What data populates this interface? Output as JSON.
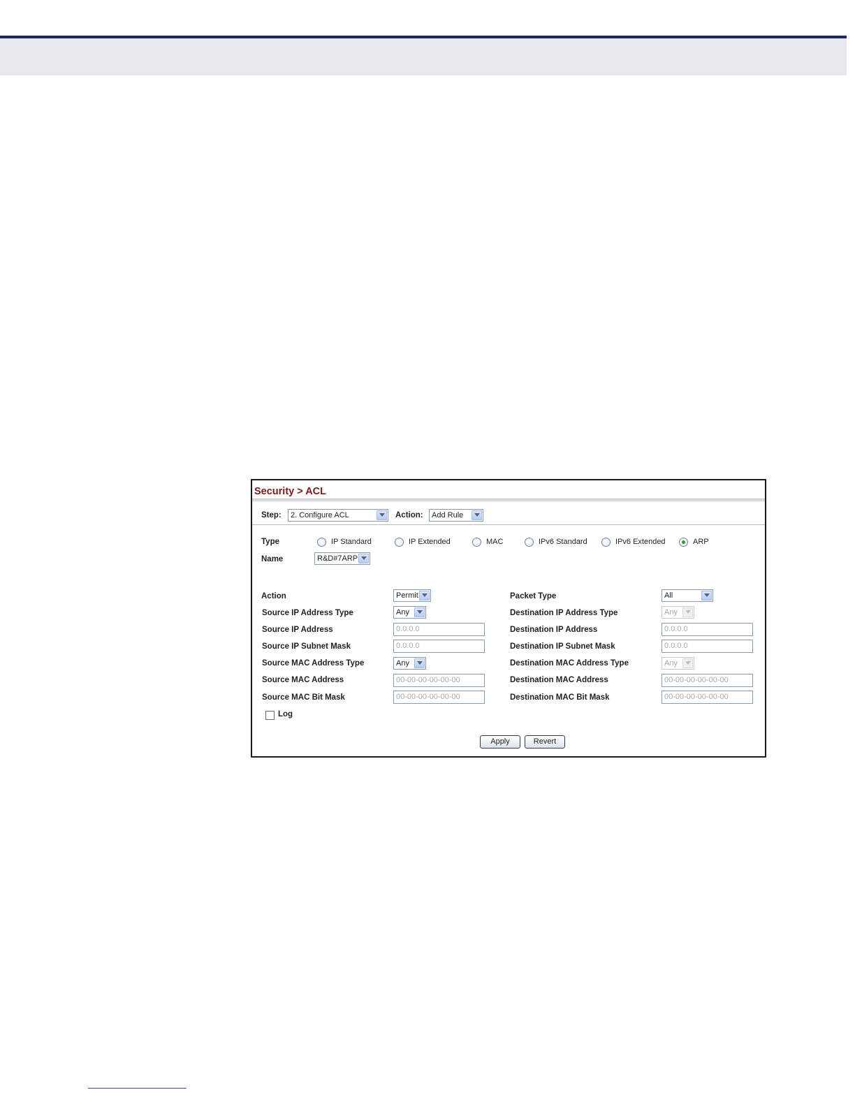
{
  "breadcrumb": {
    "section": "Security",
    "separator": ">",
    "page": "ACL",
    "full": "Security > ACL"
  },
  "step": {
    "label": "Step:",
    "value": "2. Configure ACL"
  },
  "top_action": {
    "label": "Action:",
    "value": "Add Rule"
  },
  "type": {
    "label": "Type",
    "options": [
      {
        "label": "IP Standard",
        "checked": false
      },
      {
        "label": "IP Extended",
        "checked": false
      },
      {
        "label": "MAC",
        "checked": false
      },
      {
        "label": "IPv6 Standard",
        "checked": false
      },
      {
        "label": "IPv6 Extended",
        "checked": false
      },
      {
        "label": "ARP",
        "checked": true
      }
    ]
  },
  "name": {
    "label": "Name",
    "value": "R&D#7ARP"
  },
  "rule": {
    "action": {
      "label": "Action",
      "value": "Permit"
    },
    "packet_type": {
      "label": "Packet Type",
      "value": "All"
    },
    "src_ip_type": {
      "label": "Source IP Address Type",
      "value": "Any"
    },
    "dst_ip_type": {
      "label": "Destination IP Address Type",
      "value": "Any"
    },
    "src_ip": {
      "label": "Source IP Address",
      "value": "0.0.0.0"
    },
    "dst_ip": {
      "label": "Destination IP Address",
      "value": "0.0.0.0"
    },
    "src_ip_mask": {
      "label": "Source IP Subnet Mask",
      "value": "0.0.0.0"
    },
    "dst_ip_mask": {
      "label": "Destination IP Subnet Mask",
      "value": "0.0.0.0"
    },
    "src_mac_type": {
      "label": "Source MAC Address Type",
      "value": "Any"
    },
    "dst_mac_type": {
      "label": "Destination MAC Address Type",
      "value": "Any"
    },
    "src_mac": {
      "label": "Source MAC Address",
      "value": "00-00-00-00-00-00"
    },
    "dst_mac": {
      "label": "Destination MAC Address",
      "value": "00-00-00-00-00-00"
    },
    "src_mac_mask": {
      "label": "Source MAC Bit Mask",
      "value": "00-00-00-00-00-00"
    },
    "dst_mac_mask": {
      "label": "Destination MAC Bit Mask",
      "value": "00-00-00-00-00-00"
    }
  },
  "log": {
    "label": "Log",
    "checked": false
  },
  "buttons": {
    "apply": "Apply",
    "revert": "Revert"
  },
  "colors": {
    "title": "#7a1a1a",
    "header_rule": "#1b2a5e",
    "header_band": "#e7e9ef",
    "radio_selected": "#2f9a2f"
  },
  "icons": {
    "dropdown": "chevron-down-icon",
    "radio": "radio-icon",
    "checkbox": "checkbox-icon"
  }
}
